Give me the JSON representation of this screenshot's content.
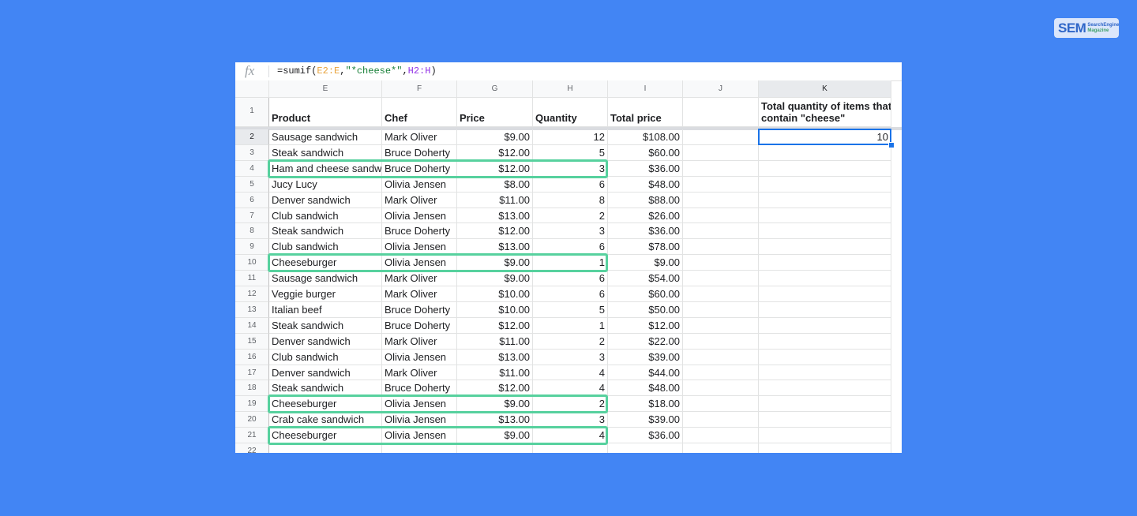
{
  "brand": {
    "logo_main": "SEM",
    "logo_m": "M",
    "logo_sub1": "SearchEngine",
    "logo_sub2": "Magazine"
  },
  "formula_bar": {
    "fx_label": "fx",
    "parts": [
      "=sumif(",
      "E2:E",
      ",",
      "\"*cheese*\"",
      ",",
      "H2:H",
      ")"
    ]
  },
  "columns": [
    "E",
    "F",
    "G",
    "H",
    "I",
    "J",
    "K"
  ],
  "header": {
    "row_number": "1",
    "product": "Product",
    "chef": "Chef",
    "price": "Price",
    "quantity": "Quantity",
    "total": "Total price",
    "k_line1": "Total quantity of items that",
    "k_line2": "contain \"cheese\""
  },
  "rows": [
    {
      "n": "2",
      "product": "Sausage sandwich",
      "chef": "Mark Oliver",
      "price": "$9.00",
      "qty": "12",
      "total": "$108.00",
      "k": "10"
    },
    {
      "n": "3",
      "product": "Steak sandwich",
      "chef": "Bruce Doherty",
      "price": "$12.00",
      "qty": "5",
      "total": "$60.00",
      "k": ""
    },
    {
      "n": "4",
      "product": "Ham and cheese sandwich",
      "chef": "Bruce Doherty",
      "price": "$12.00",
      "qty": "3",
      "total": "$36.00",
      "k": ""
    },
    {
      "n": "5",
      "product": "Jucy Lucy",
      "chef": "Olivia Jensen",
      "price": "$8.00",
      "qty": "6",
      "total": "$48.00",
      "k": ""
    },
    {
      "n": "6",
      "product": "Denver sandwich",
      "chef": "Mark Oliver",
      "price": "$11.00",
      "qty": "8",
      "total": "$88.00",
      "k": ""
    },
    {
      "n": "7",
      "product": "Club sandwich",
      "chef": "Olivia Jensen",
      "price": "$13.00",
      "qty": "2",
      "total": "$26.00",
      "k": ""
    },
    {
      "n": "8",
      "product": "Steak sandwich",
      "chef": "Bruce Doherty",
      "price": "$12.00",
      "qty": "3",
      "total": "$36.00",
      "k": ""
    },
    {
      "n": "9",
      "product": "Club sandwich",
      "chef": "Olivia Jensen",
      "price": "$13.00",
      "qty": "6",
      "total": "$78.00",
      "k": ""
    },
    {
      "n": "10",
      "product": "Cheeseburger",
      "chef": "Olivia Jensen",
      "price": "$9.00",
      "qty": "1",
      "total": "$9.00",
      "k": ""
    },
    {
      "n": "11",
      "product": "Sausage sandwich",
      "chef": "Mark Oliver",
      "price": "$9.00",
      "qty": "6",
      "total": "$54.00",
      "k": ""
    },
    {
      "n": "12",
      "product": "Veggie burger",
      "chef": "Mark Oliver",
      "price": "$10.00",
      "qty": "6",
      "total": "$60.00",
      "k": ""
    },
    {
      "n": "13",
      "product": "Italian beef",
      "chef": "Bruce Doherty",
      "price": "$10.00",
      "qty": "5",
      "total": "$50.00",
      "k": ""
    },
    {
      "n": "14",
      "product": "Steak sandwich",
      "chef": "Bruce Doherty",
      "price": "$12.00",
      "qty": "1",
      "total": "$12.00",
      "k": ""
    },
    {
      "n": "15",
      "product": "Denver sandwich",
      "chef": "Mark Oliver",
      "price": "$11.00",
      "qty": "2",
      "total": "$22.00",
      "k": ""
    },
    {
      "n": "16",
      "product": "Club sandwich",
      "chef": "Olivia Jensen",
      "price": "$13.00",
      "qty": "3",
      "total": "$39.00",
      "k": ""
    },
    {
      "n": "17",
      "product": "Denver sandwich",
      "chef": "Mark Oliver",
      "price": "$11.00",
      "qty": "4",
      "total": "$44.00",
      "k": ""
    },
    {
      "n": "18",
      "product": "Steak sandwich",
      "chef": "Bruce Doherty",
      "price": "$12.00",
      "qty": "4",
      "total": "$48.00",
      "k": ""
    },
    {
      "n": "19",
      "product": "Cheeseburger",
      "chef": "Olivia Jensen",
      "price": "$9.00",
      "qty": "2",
      "total": "$18.00",
      "k": ""
    },
    {
      "n": "20",
      "product": "Crab cake sandwich",
      "chef": "Olivia Jensen",
      "price": "$13.00",
      "qty": "3",
      "total": "$39.00",
      "k": ""
    },
    {
      "n": "21",
      "product": "Cheeseburger",
      "chef": "Olivia Jensen",
      "price": "$9.00",
      "qty": "4",
      "total": "$36.00",
      "k": ""
    },
    {
      "n": "22",
      "product": "",
      "chef": "",
      "price": "",
      "qty": "",
      "total": "",
      "k": ""
    }
  ],
  "highlighted_rows": [
    "4",
    "10",
    "19",
    "21"
  ],
  "colors": {
    "background": "#4285f4",
    "highlight": "#57d19e",
    "selection": "#1a73e8"
  }
}
